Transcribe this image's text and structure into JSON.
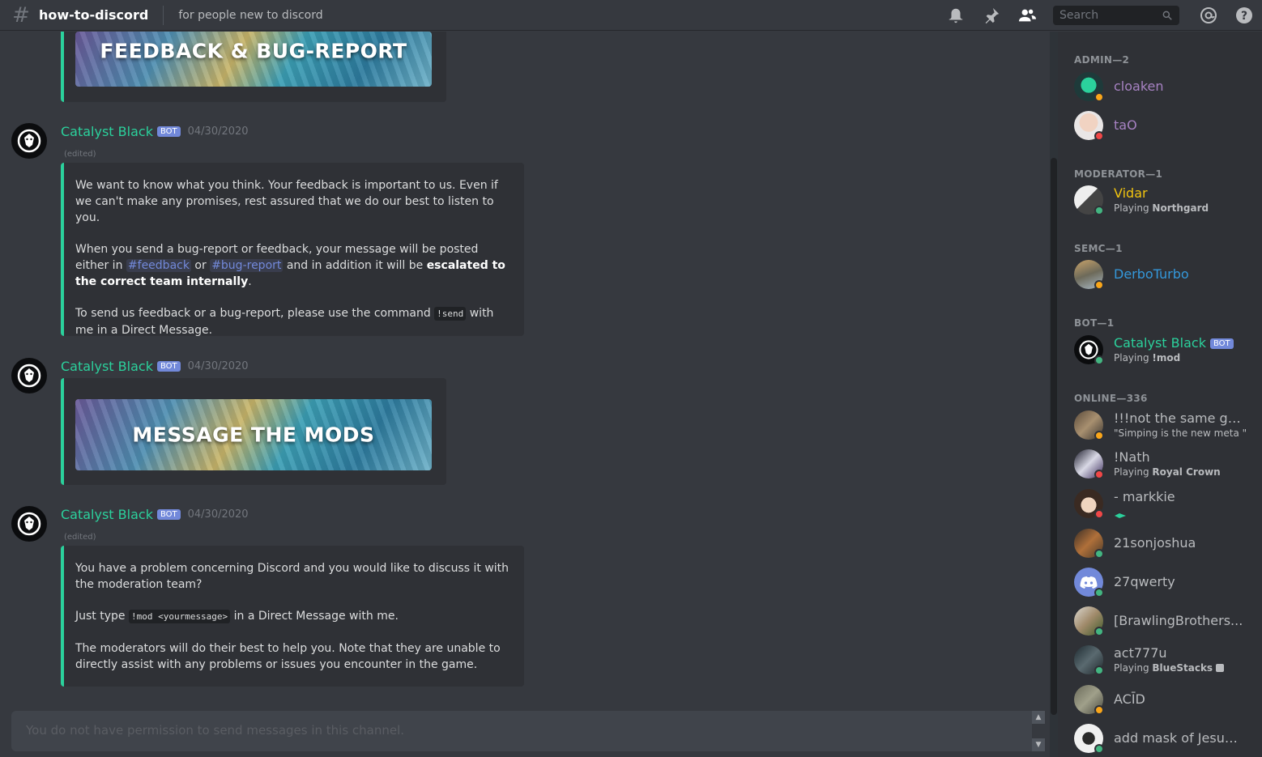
{
  "header": {
    "channel": "how-to-discord",
    "topic": "for people new to discord",
    "search_placeholder": "Search"
  },
  "messages": {
    "banner1_text": "FEEDBACK & BUG-REPORT",
    "banner2_text": "MESSAGE THE MODS",
    "bot_tag": "BOT",
    "edited": "(edited)",
    "msg1": {
      "author": "Catalyst Black",
      "timestamp": "04/30/2020",
      "p1": "We want to know what you think. Your feedback is important to us. Even if we can't make any promises, rest assured that we do our best to listen to you.",
      "p2_a": "When you send a bug-report or feedback, your message will be posted either in ",
      "mention1": "#feedback",
      "p2_or": " or ",
      "mention2": "#bug-report",
      "p2_b": " and in addition it will be ",
      "p2_bold": "escalated to the correct team internally",
      "p2_end": ".",
      "p3_a": "To send us feedback or a bug-report, please use the command ",
      "p3_code": "!send",
      "p3_b": " with me in a Direct Message."
    },
    "msg2": {
      "author": "Catalyst Black",
      "timestamp": "04/30/2020"
    },
    "msg3": {
      "author": "Catalyst Black",
      "timestamp": "04/30/2020",
      "p1": "You have a problem concerning Discord and you would like to discuss it with the moderation team?",
      "p2_a": "Just type ",
      "p2_code": "!mod <yourmessage>",
      "p2_b": " in a Direct Message with me.",
      "p3": "The moderators will do their best to help you. Note that they are unable to directly assist with any problems or issues you encounter in the game."
    }
  },
  "input": {
    "placeholder": "You do not have permission to send messages in this channel."
  },
  "members": {
    "roles": {
      "admin": "ADMIN—2",
      "moderator": "MODERATOR—1",
      "semc": "SEMC—1",
      "bot": "BOT—1",
      "online": "ONLINE—336"
    },
    "list": [
      {
        "name": "cloaken",
        "color": "#a782c3",
        "status": "idle",
        "sub": ""
      },
      {
        "name": "taO",
        "color": "#a782c3",
        "status": "dnd",
        "sub": ""
      },
      {
        "name": "Vidar",
        "color": "#f1c40f",
        "status": "online",
        "sub_prefix": "Playing ",
        "sub_bold": "Northgard"
      },
      {
        "name": "DerboTurbo",
        "color": "#3498db",
        "status": "idle",
        "sub": ""
      },
      {
        "name": "Catalyst Black",
        "color": "#2bd19c",
        "status": "online",
        "sub_prefix": "Playing ",
        "sub_bold": "!mod",
        "tag": "BOT"
      },
      {
        "name": "!!!not the same guy",
        "color": "#b9bbbe",
        "status": "idle",
        "sub": "\"Simping is the new meta \""
      },
      {
        "name": "!Nath",
        "color": "#b9bbbe",
        "status": "dnd",
        "sub_prefix": "Playing ",
        "sub_bold": "Royal Crown"
      },
      {
        "name": "- markkie",
        "color": "#b9bbbe",
        "status": "dnd",
        "sub": ""
      },
      {
        "name": "21sonjoshua",
        "color": "#b9bbbe",
        "status": "online",
        "sub": ""
      },
      {
        "name": "27qwerty",
        "color": "#b9bbbe",
        "status": "online",
        "sub": ""
      },
      {
        "name": "[BrawlingBrothers...",
        "color": "#b9bbbe",
        "status": "online",
        "sub": ""
      },
      {
        "name": "act777u",
        "color": "#b9bbbe",
        "status": "online",
        "sub_prefix": "Playing ",
        "sub_bold": "BlueStacks"
      },
      {
        "name": "ACĪD",
        "color": "#b9bbbe",
        "status": "idle",
        "sub": ""
      },
      {
        "name": "add mask of Jesus ...",
        "color": "#b9bbbe",
        "status": "online",
        "sub": ""
      }
    ]
  },
  "colors": {
    "accent": "#2bd19c",
    "blurple": "#7289da",
    "online": "#43b581",
    "idle": "#faa61a",
    "dnd": "#f04747"
  }
}
